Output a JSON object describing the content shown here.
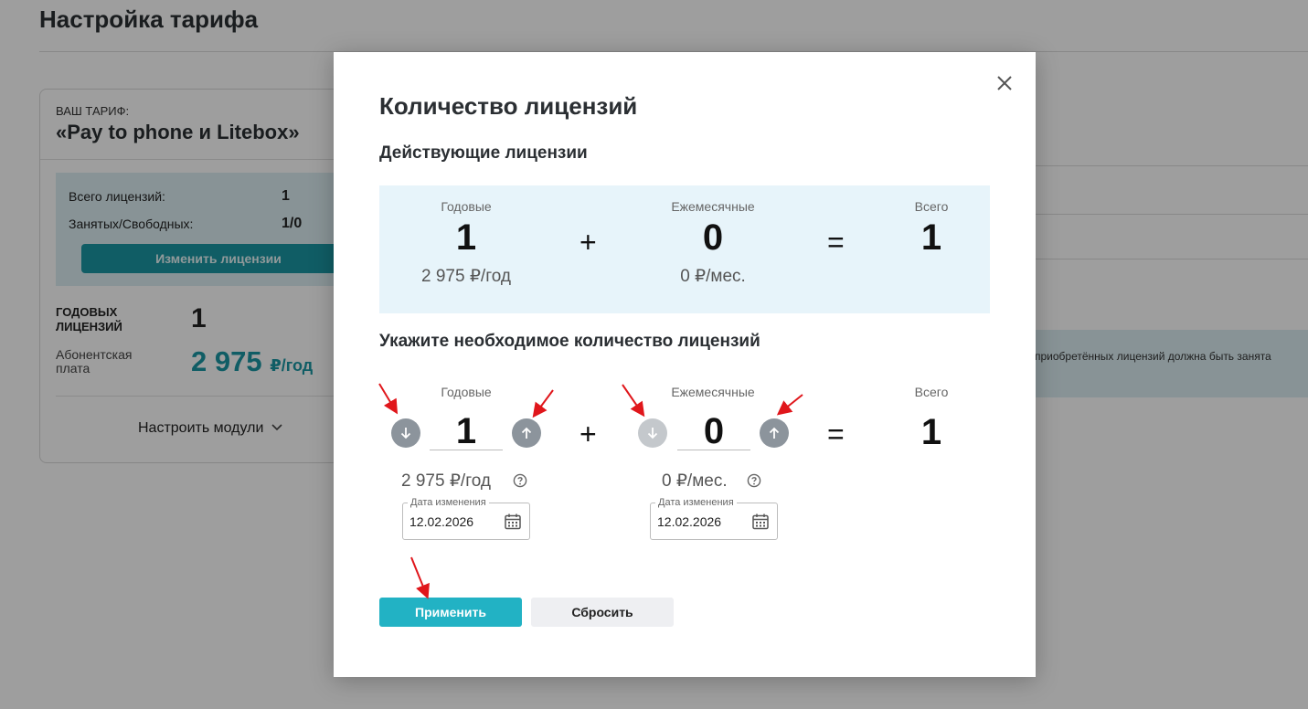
{
  "background": {
    "page_title": "Настройка тарифа",
    "tariff": {
      "caption": "ВАШ ТАРИФ:",
      "name": "«Pay to phone и Litebox»",
      "total_licenses_label": "Всего лицензий:",
      "total_licenses_value": "1",
      "busy_free_label": "Занятых/Свободных:",
      "busy_free_value": "1/0",
      "change_button": "Изменить лицензии",
      "annual_label": "ГОДОВЫХ лицензий",
      "annual_value": "1",
      "fee_label": "Абонентская плата",
      "fee_value": "2 975",
      "fee_unit": "₽/год",
      "modules_link": "Настроить модули"
    },
    "info_text": "приобретённых лицензий должна быть занята"
  },
  "modal": {
    "title": "Количество лицензий",
    "current_section_title": "Действующие лицензии",
    "current": {
      "annual_label": "Годовые",
      "annual_value": "1",
      "annual_price": "2 975 ₽/год",
      "monthly_label": "Ежемесячные",
      "monthly_value": "0",
      "monthly_price": "0 ₽/мес.",
      "total_label": "Всего",
      "total_value": "1",
      "plus": "+",
      "equals": "="
    },
    "needed_section_title": "Укажите необходимое количество лицензий",
    "needed": {
      "annual_label": "Годовые",
      "annual_value": "1",
      "annual_price": "2 975 ₽/год",
      "annual_date_label": "Дата изменения",
      "annual_date": "12.02.2026",
      "monthly_label": "Ежемесячные",
      "monthly_value": "0",
      "monthly_price": "0 ₽/мес.",
      "monthly_date_label": "Дата изменения",
      "monthly_date": "12.02.2026",
      "total_label": "Всего",
      "total_value": "1",
      "plus": "+",
      "equals": "="
    },
    "apply_button": "Применить",
    "reset_button": "Сбросить"
  },
  "colors": {
    "accent": "#22b2c4",
    "accent_dark": "#1b97a3",
    "summary_bg": "#e7f4fa",
    "marker": "#e0161b"
  },
  "icons": [
    "close-icon",
    "arrow-down-icon",
    "arrow-up-icon",
    "help-icon",
    "calendar-icon",
    "chevron-down-icon"
  ]
}
